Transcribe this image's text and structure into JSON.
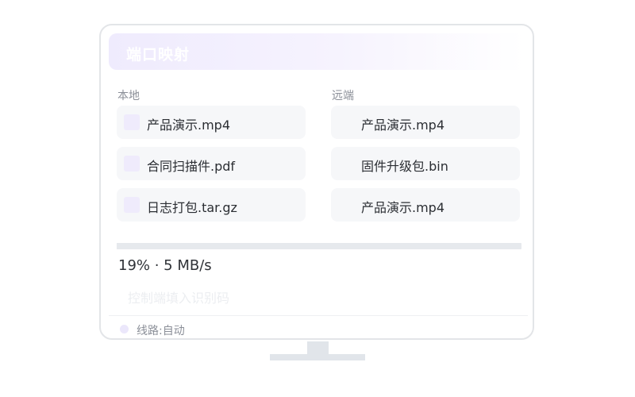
{
  "window": {
    "title": "端口映射",
    "title_glyph": "⠿"
  },
  "local": {
    "label": "本地",
    "files": [
      "产品演示.mp4",
      "合同扫描件.pdf",
      "日志打包.tar.gz"
    ]
  },
  "remote": {
    "label": "远端",
    "files": [
      "产品演示.mp4",
      "固件升级包.bin",
      "产品演示.mp4"
    ]
  },
  "transfer": {
    "progress": 0.19,
    "status_text": "19% · 5 MB/s"
  },
  "code_input": {
    "placeholder": "控制端填入识别码",
    "value": ""
  },
  "footer": {
    "route": "线路:自动"
  },
  "colors": {
    "accent_light": "#efebfc",
    "card_bg": "#f6f7f9",
    "track": "#e6e9ed"
  }
}
